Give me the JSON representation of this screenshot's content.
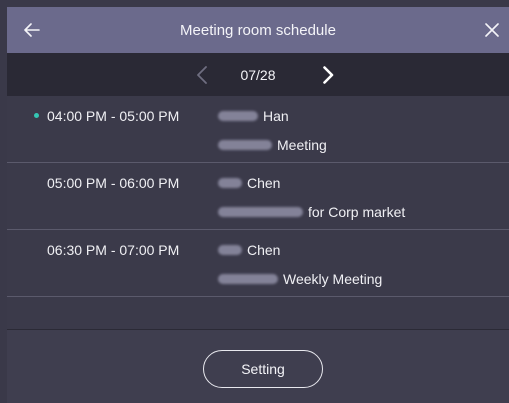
{
  "header": {
    "title": "Meeting room schedule",
    "back_icon": "arrow-left-icon",
    "close_icon": "close-icon"
  },
  "date_nav": {
    "date": "07/28",
    "prev_icon": "chevron-left-icon",
    "next_icon": "chevron-right-icon"
  },
  "meetings": [
    {
      "time": "04:00 PM - 05:00 PM",
      "organizer": "Han",
      "subject": "Meeting",
      "current": true
    },
    {
      "time": "05:00 PM - 06:00 PM",
      "organizer": "Chen",
      "subject": "for Corp market",
      "current": false
    },
    {
      "time": "06:30 PM - 07:00 PM",
      "organizer": "Chen",
      "subject": "Weekly Meeting",
      "current": false
    }
  ],
  "footer": {
    "setting_label": "Setting"
  },
  "colors": {
    "title_bar": "#6b6a8c",
    "date_bar": "#2a2935",
    "background": "#3b3a4a",
    "current_indicator": "#34c6b4"
  }
}
